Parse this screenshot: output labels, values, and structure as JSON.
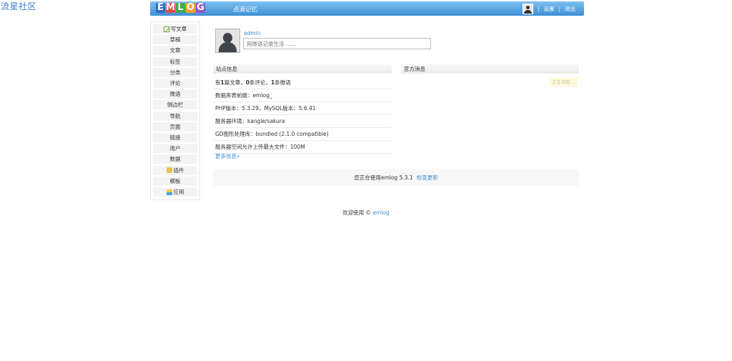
{
  "watermark": "流星社区",
  "header": {
    "logo_letters": [
      "E",
      "M",
      "L",
      "O",
      "G"
    ],
    "logo_colors": [
      "#2f6fc5",
      "#e84c3d",
      "#3faa48",
      "#f4a21d",
      "#8e5bc4"
    ],
    "site_title": "点滴记忆",
    "settings_label": "设置",
    "logout_label": "退出",
    "separator": "|"
  },
  "sidebar": {
    "items": [
      {
        "label": "写文章",
        "icon": "write-icon"
      },
      {
        "label": "草稿"
      },
      {
        "label": "文章"
      },
      {
        "label": "标签"
      },
      {
        "label": "分类"
      },
      {
        "label": "评论"
      },
      {
        "label": "微语"
      },
      {
        "label": "侧边栏"
      },
      {
        "label": "导航"
      },
      {
        "label": "页面"
      },
      {
        "label": "链接"
      },
      {
        "label": "用户"
      },
      {
        "label": "数据"
      },
      {
        "label": "插件",
        "icon": "plugin-icon"
      },
      {
        "label": "模板"
      },
      {
        "label": "应用",
        "icon": "app-icon"
      }
    ]
  },
  "profile": {
    "username": "admin",
    "status_placeholder": "用微语记录生活 ……"
  },
  "site_info": {
    "title": "站点信息",
    "stats": {
      "prefix": "有",
      "articles": "1",
      "articles_unit": "篇文章，",
      "comments": "0",
      "comments_unit": "条评论，",
      "twitters": "1",
      "twitters_unit": "条微语"
    },
    "rows": [
      "数据库表前缀：emlog_",
      "PHP版本：5.3.29，MySQL版本：5.6.41",
      "服务器环境：kangle/sakura",
      "GD图形处理库：bundled (2.1.0 compatible)",
      "服务器空间允许上传最大文件：100M"
    ],
    "more_link": "更多信息»"
  },
  "official_news": {
    "title": "官方消息",
    "loading": "正在读取..."
  },
  "version_bar": {
    "text": "您正在使用emlog 5.3.1",
    "check_update": "检查更新"
  },
  "footer": {
    "text": "欢迎使用 ©",
    "link": "emlog"
  }
}
